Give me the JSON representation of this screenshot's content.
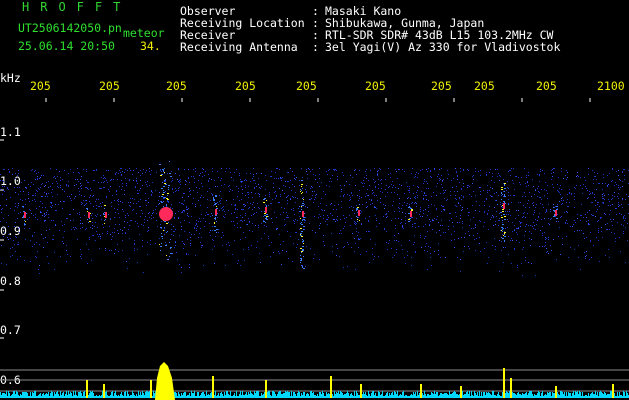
{
  "window": {
    "brand": "HROFFT",
    "filename": "UT2506142050.pn",
    "mode": "meteor",
    "datetime": "25.06.14 20:50",
    "count": "34."
  },
  "meta": [
    {
      "label": "Observer",
      "value": "Masaki Kano"
    },
    {
      "label": "Receiving Location",
      "value": "Shibukawa, Gunma, Japan"
    },
    {
      "label": "Receiver",
      "value": "RTL-SDR SDR# 43dB L15 103.2MHz CW"
    },
    {
      "label": "Receiving Antenna",
      "value": "3el Yagi(V) Az 330 for Vladivostok"
    }
  ],
  "axis": {
    "unit": "kHz",
    "x_ticks": [
      "205",
      "205",
      "205",
      "205",
      "205",
      "205",
      "205",
      "205",
      "205",
      "2100"
    ],
    "y_ticks": [
      "1.1",
      "1.0",
      "0.9",
      "0.8",
      "0.7",
      "0.6"
    ]
  },
  "colors": {
    "background": "#000000",
    "brand": "#32d632",
    "tick": "#f0f000",
    "noise": "#1a35c8",
    "echo_hot": "#ff2a5a",
    "power_trace": "#ffff00",
    "baseline": "#00d8ff"
  }
}
